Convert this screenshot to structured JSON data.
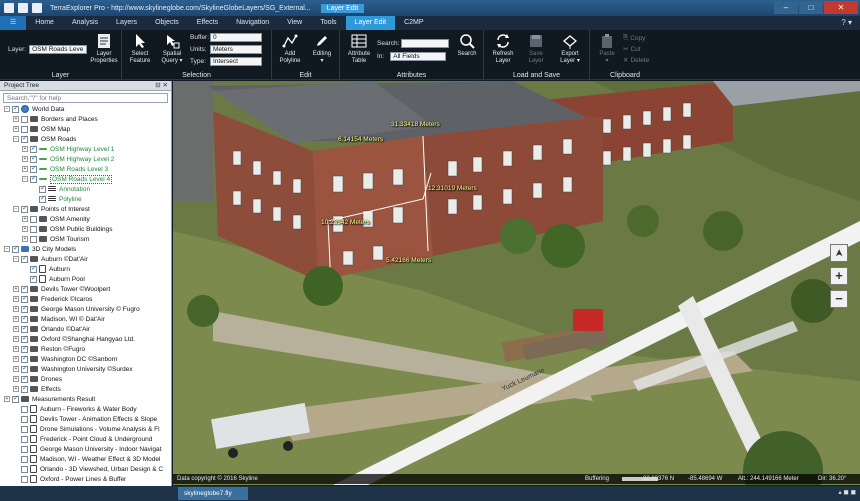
{
  "titlebar": {
    "title": "TerraExplorer Pro - http://www.skylineglobe.com/SkylineGlobeLayers/SG_External...",
    "context_tab": "Layer Edit",
    "minimize": "–",
    "maximize": "□",
    "close": "✕"
  },
  "menu": {
    "file": "☰",
    "tabs": [
      "Home",
      "Analysis",
      "Layers",
      "Objects",
      "Effects",
      "Navigation",
      "View",
      "Tools",
      "Layer Edit",
      "C2MP"
    ],
    "active": "Layer Edit",
    "help": "? ▾"
  },
  "ribbon": {
    "layer_group": {
      "title": "Layer",
      "layer_label": "Layer:",
      "layer_value": "OSM Roads Leve",
      "properties": "Layer\nProperties"
    },
    "selection_group": {
      "title": "Selection",
      "select_feature": "Select\nFeature",
      "spatial_query": "Spatial\nQuery ▾",
      "buffer_label": "Buffer:",
      "buffer_value": "0",
      "units_label": "Units:",
      "units_value": "Meters",
      "type_label": "Type:",
      "type_value": "Intersect"
    },
    "edit_group": {
      "title": "Edit",
      "add_polyline": "Add\nPolyline",
      "editing": "Editing\n▾"
    },
    "attributes_group": {
      "title": "Attributes",
      "attribute_table": "Attribute\nTable",
      "search_label": "Search:",
      "in_label": "In:",
      "in_value": "All Fields",
      "search": "Search"
    },
    "load_save_group": {
      "title": "Load and Save",
      "refresh": "Refresh\nLayer",
      "save": "Save\nLayer",
      "export": "Export\nLayer ▾"
    },
    "clipboard_group": {
      "title": "Clipboard",
      "paste": "Paste\n▾",
      "copy": "Copy",
      "cut": "Cut",
      "delete": "Delete"
    }
  },
  "tree": {
    "header": "Project Tree",
    "header_buttons": "⊟ ✕",
    "search_placeholder": "Search,\"?\" for help",
    "items": [
      {
        "label": "World Data",
        "level": 0,
        "toggle": "−",
        "checked": true,
        "icon": "globe"
      },
      {
        "label": "Borders and Places",
        "level": 1,
        "toggle": "+",
        "checked": false,
        "icon": "folder"
      },
      {
        "label": "OSM Map",
        "level": 1,
        "toggle": "+",
        "checked": false,
        "icon": "folder"
      },
      {
        "label": "OSM Roads",
        "level": 1,
        "toggle": "−",
        "checked": true,
        "icon": "folder"
      },
      {
        "label": "OSM Highway Level 1",
        "level": 2,
        "toggle": "+",
        "checked": true,
        "icon": "line",
        "green": true
      },
      {
        "label": "OSM Highway Level 2",
        "level": 2,
        "toggle": "+",
        "checked": true,
        "icon": "line",
        "green": true
      },
      {
        "label": "OSM Roads Level 3",
        "level": 2,
        "toggle": "+",
        "checked": true,
        "icon": "line",
        "green": true
      },
      {
        "label": "OSM Roads Level 4",
        "level": 2,
        "toggle": "−",
        "checked": true,
        "icon": "line",
        "green": true,
        "selected": true
      },
      {
        "label": "Annotation",
        "level": 3,
        "toggle": "",
        "checked": true,
        "icon": "lines",
        "green": true
      },
      {
        "label": "Polyline",
        "level": 3,
        "toggle": "",
        "checked": true,
        "icon": "lines",
        "green": true
      },
      {
        "label": "Points of Interest",
        "level": 1,
        "toggle": "−",
        "checked": true,
        "icon": "folder"
      },
      {
        "label": "OSM Amenity",
        "level": 2,
        "toggle": "+",
        "checked": false,
        "icon": "folder"
      },
      {
        "label": "OSM Public Buildings",
        "level": 2,
        "toggle": "+",
        "checked": false,
        "icon": "folder"
      },
      {
        "label": "OSM Tourism",
        "level": 2,
        "toggle": "+",
        "checked": false,
        "icon": "folder"
      },
      {
        "label": "3D City Models",
        "level": 0,
        "toggle": "−",
        "checked": true,
        "icon": "blue"
      },
      {
        "label": "Auburn ©Dat'Air",
        "level": 1,
        "toggle": "−",
        "checked": true,
        "icon": "folder"
      },
      {
        "label": "Auburn",
        "level": 2,
        "toggle": "",
        "checked": true,
        "icon": "doc"
      },
      {
        "label": "Auburn Pool",
        "level": 2,
        "toggle": "",
        "checked": true,
        "icon": "doc"
      },
      {
        "label": "Devils Tower ©Woolpert",
        "level": 1,
        "toggle": "+",
        "checked": true,
        "icon": "folder"
      },
      {
        "label": "Frederick ©Icaros",
        "level": 1,
        "toggle": "+",
        "checked": true,
        "icon": "folder"
      },
      {
        "label": "George Mason University © Fugro",
        "level": 1,
        "toggle": "+",
        "checked": true,
        "icon": "folder"
      },
      {
        "label": "Madison, WI © Dat'Air",
        "level": 1,
        "toggle": "+",
        "checked": true,
        "icon": "folder"
      },
      {
        "label": "Orlando ©Dat'Air",
        "level": 1,
        "toggle": "+",
        "checked": true,
        "icon": "folder"
      },
      {
        "label": "Oxford ©Shanghai Hangyao Ltd.",
        "level": 1,
        "toggle": "+",
        "checked": true,
        "icon": "folder"
      },
      {
        "label": "Reston ©Fugro",
        "level": 1,
        "toggle": "+",
        "checked": true,
        "icon": "folder"
      },
      {
        "label": "Washington DC ©Sanborn",
        "level": 1,
        "toggle": "+",
        "checked": true,
        "icon": "folder"
      },
      {
        "label": "Washington University ©Surdex",
        "level": 1,
        "toggle": "+",
        "checked": true,
        "icon": "folder"
      },
      {
        "label": "Drones",
        "level": 1,
        "toggle": "+",
        "checked": true,
        "icon": "folder"
      },
      {
        "label": "Effects",
        "level": 1,
        "toggle": "+",
        "checked": true,
        "icon": "folder"
      },
      {
        "label": "Measurements Result",
        "level": 0,
        "toggle": "+",
        "checked": true,
        "icon": "folder"
      },
      {
        "label": "Auburn - Fireworks & Water Body",
        "level": 1,
        "toggle": "",
        "checked": false,
        "icon": "doc"
      },
      {
        "label": "Devils Tower - Animation Effects & Slope",
        "level": 1,
        "toggle": "",
        "checked": false,
        "icon": "doc"
      },
      {
        "label": "Drone Simulations - Volume Analysis & Fl",
        "level": 1,
        "toggle": "",
        "checked": false,
        "icon": "doc"
      },
      {
        "label": "Frederick - Point Cloud & Underground",
        "level": 1,
        "toggle": "",
        "checked": false,
        "icon": "doc"
      },
      {
        "label": "George Mason University - Indoor Navigat",
        "level": 1,
        "toggle": "",
        "checked": false,
        "icon": "doc"
      },
      {
        "label": "Madison, WI - Weather Effect & 3D Model",
        "level": 1,
        "toggle": "",
        "checked": false,
        "icon": "doc"
      },
      {
        "label": "Orlando - 3D Viewshed, Urban Design & C",
        "level": 1,
        "toggle": "",
        "checked": false,
        "icon": "doc"
      },
      {
        "label": "Oxford - Power Lines & Buffer",
        "level": 1,
        "toggle": "",
        "checked": false,
        "icon": "doc"
      }
    ]
  },
  "map": {
    "measurements": [
      {
        "id": "m1",
        "text": "6.14154 Meters"
      },
      {
        "id": "m2",
        "text": "31.33418 Meters"
      },
      {
        "id": "m3",
        "text": "12.31019 Meters"
      },
      {
        "id": "m4",
        "text": "10.23342 Meters"
      },
      {
        "id": "m5",
        "text": "5.42166 Meters"
      }
    ],
    "road_label": "Yuck Leumane",
    "north_arrow": "➤",
    "zoom_in": "+",
    "zoom_out": "−"
  },
  "status": {
    "copyright": "Data copyright © 2016 Skyline",
    "buffering": "Buffering",
    "lat": "32.60376 N",
    "lon": "-85.48694 W",
    "alt": "Alt.: 244.149166 Meter",
    "dir": "Dir: 36.20°"
  },
  "taskbar": {
    "start": "skylineglobe7.fly",
    "active_window": "skylineglobe7.fly"
  }
}
